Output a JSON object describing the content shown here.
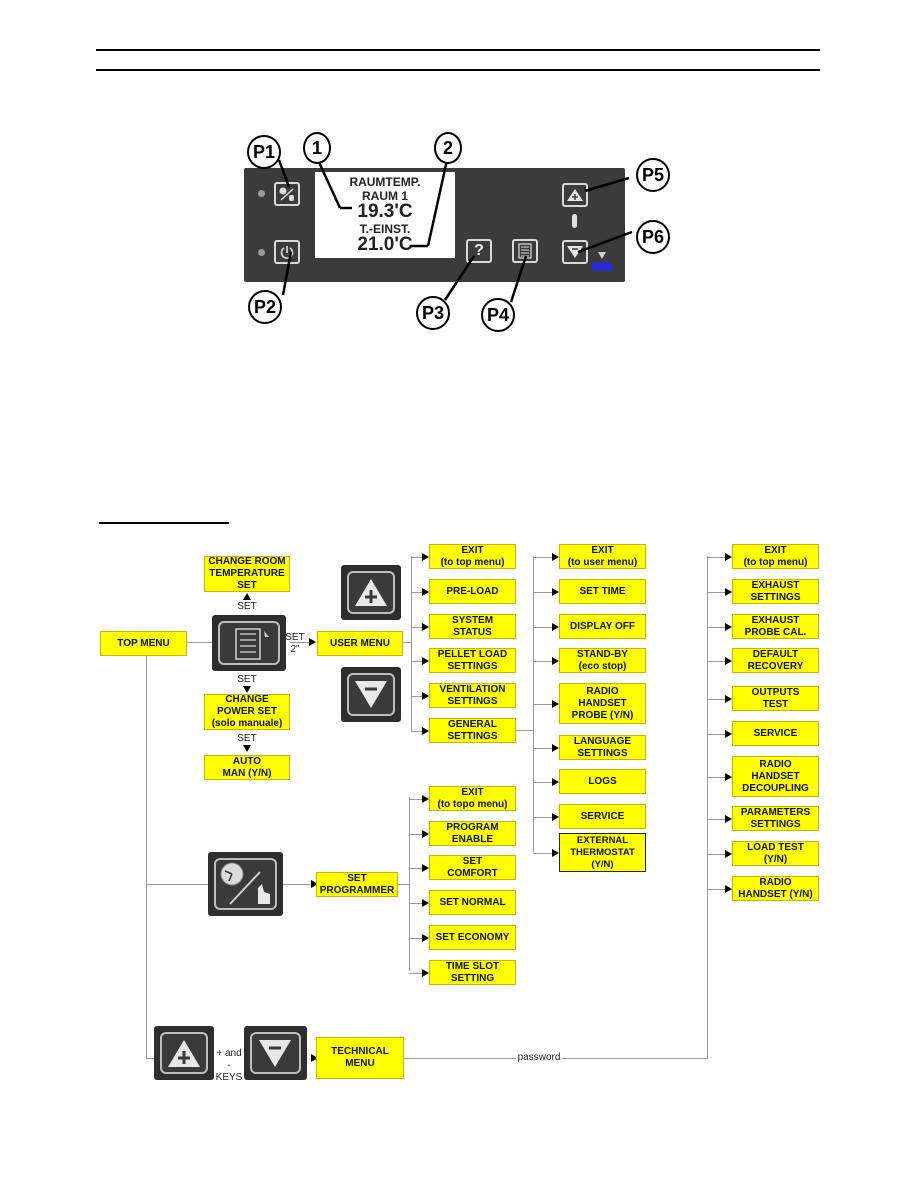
{
  "panel": {
    "display": {
      "line1": "RAUMTEMP.",
      "line2": "RAUM 1",
      "room_temp": "19.3'C",
      "line4": "T.-EINST.",
      "set_temp": "21.0'C"
    },
    "callouts": {
      "p1": "P1",
      "p2": "P2",
      "p3": "P3",
      "p4": "P4",
      "p5": "P5",
      "p6": "P6",
      "n1": "1",
      "n2": "2"
    },
    "buttons": {
      "p3_glyph": "?",
      "p1_icon": "programmer-hand-icon",
      "p2_icon": "power-icon",
      "p4_icon": "menu-list-icon",
      "p5_icon": "plus-triangle-icon",
      "p6_icon": "minus-triangle-icon"
    },
    "status_colors": {
      "led": "#9a9a9a",
      "blue_indicator": "#2a2ad0"
    }
  },
  "diagram": {
    "top_menu": "TOP MENU",
    "change_room_temp": "CHANGE ROOM\nTEMPERATURE\nSET",
    "set_label_up": "SET",
    "set_label_down": "SET",
    "set_label_down2": "SET",
    "set_2s_label": "SET\n2\"",
    "change_power": "CHANGE\nPOWER SET\n(solo manuale)",
    "auto_man": "AUTO\nMAN (Y/N)",
    "user_menu": "USER MENU",
    "user_menu_items": [
      "EXIT\n(to top menu)",
      "PRE-LOAD",
      "SYSTEM\nSTATUS",
      "PELLET LOAD\nSETTINGS",
      "VENTILATION\nSETTINGS",
      "GENERAL\nSETTINGS"
    ],
    "general_settings_items": [
      "EXIT\n(to user menu)",
      "SET TIME",
      "DISPLAY OFF",
      "STAND-BY\n(eco stop)",
      "RADIO\nHANDSET\nPROBE (Y/N)",
      "LANGUAGE\nSETTINGS",
      "LOGS",
      "SERVICE",
      "EXTERNAL\nTHERMOSTAT\n(Y/N)"
    ],
    "set_programmer": "SET\nPROGRAMMER",
    "programmer_items": [
      "EXIT\n(to topo menu)",
      "PROGRAM\nENABLE",
      "SET\nCOMFORT",
      "SET NORMAL",
      "SET ECONOMY",
      "TIME SLOT\nSETTING"
    ],
    "keys_label": "+ and -\nKEYS",
    "technical_menu": "TECHNICAL\nMENU",
    "password_label": "password",
    "technical_items": [
      "EXIT\n(to top menu)",
      "EXHAUST\nSETTINGS",
      "EXHAUST\nPROBE CAL.",
      "DEFAULT\nRECOVERY",
      "OUTPUTS\nTEST",
      "SERVICE",
      "RADIO\nHANDSET\nDECOUPLING",
      "PARAMETERS\nSETTINGS",
      "LOAD TEST\n(Y/N)",
      "RADIO\nHANDSET (Y/N)"
    ],
    "box_color": "#ffff00"
  }
}
